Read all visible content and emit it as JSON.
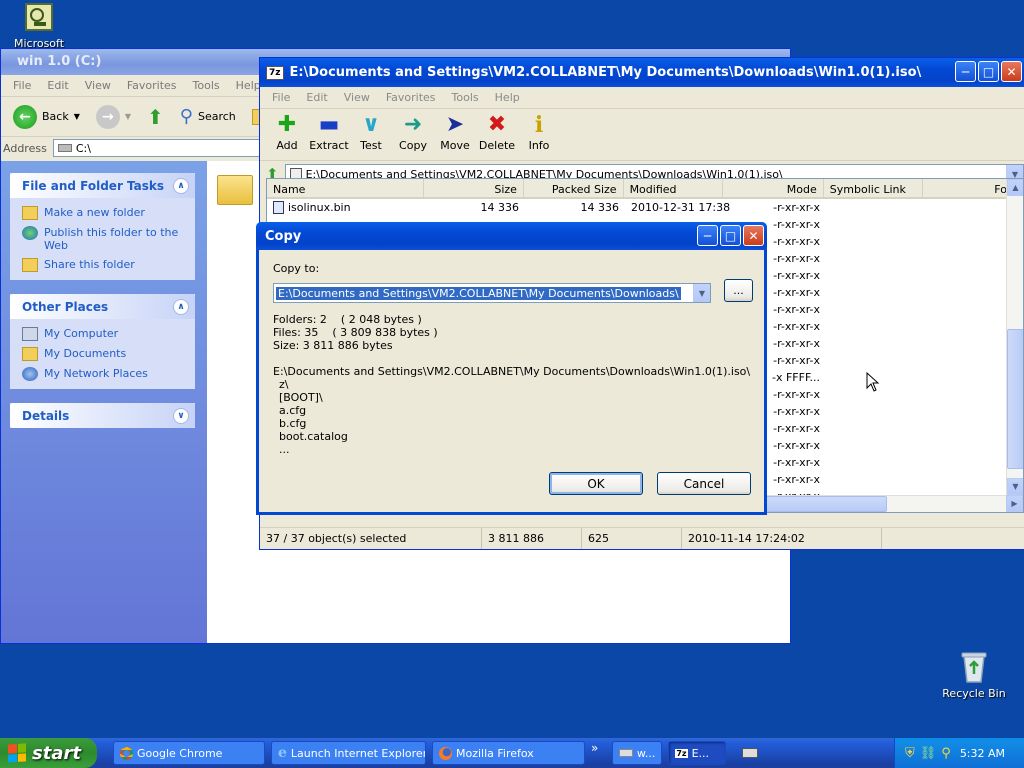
{
  "desktop": {
    "top_icon_label": "Microsoft",
    "recycle_label": "Recycle Bin"
  },
  "explorer": {
    "title": "win 1.0 (C:)",
    "menu": [
      "File",
      "Edit",
      "View",
      "Favorites",
      "Tools",
      "Help"
    ],
    "back_label": "Back",
    "search_label": "Search",
    "address_label": "Address",
    "address_value": "C:\\",
    "file_tasks": {
      "title": "File and Folder Tasks",
      "items": [
        "Make a new folder",
        "Publish this folder to the Web",
        "Share this folder"
      ]
    },
    "other_places": {
      "title": "Other Places",
      "items": [
        "My Computer",
        "My Documents",
        "My Network Places"
      ]
    },
    "details_title": "Details"
  },
  "zip": {
    "title": "E:\\Documents and Settings\\VM2.COLLABNET\\My Documents\\Downloads\\Win1.0(1).iso\\",
    "menu": [
      "File",
      "Edit",
      "View",
      "Favorites",
      "Tools",
      "Help"
    ],
    "toolbar": [
      "Add",
      "Extract",
      "Test",
      "Copy",
      "Move",
      "Delete",
      "Info"
    ],
    "path": "E:\\Documents and Settings\\VM2.COLLABNET\\My Documents\\Downloads\\Win1.0(1).iso\\",
    "columns": [
      "Name",
      "Size",
      "Packed Size",
      "Modified",
      "Mode",
      "Symbolic Link",
      "Fold"
    ],
    "first_row": {
      "name": "isolinux.bin",
      "size": "14 336",
      "packed": "14 336",
      "modified": "2010-12-31 17:38",
      "mode": "-r-xr-xr-x"
    },
    "modes": [
      "-r-xr-xr-x",
      "-r-xr-xr-x",
      "-r-xr-xr-x",
      "-r-xr-xr-x",
      "-r-xr-xr-x",
      "-r-xr-xr-x",
      "-r-xr-xr-x",
      "-r-xr-xr-x",
      "-r-xr-xr-x",
      "-x FFFF...",
      "-r-xr-xr-x",
      "-r-xr-xr-x",
      "-r-xr-xr-x",
      "-r-xr-xr-x",
      "-r-xr-xr-x",
      "-r-xr-xr-x",
      "-r-xr-xr-x",
      "-r-xr-xr-x"
    ],
    "status": [
      "37 / 37 object(s) selected",
      "3 811 886",
      "625",
      "2010-11-14 17:24:02"
    ]
  },
  "dialog": {
    "title": "Copy",
    "copy_to_label": "Copy to:",
    "destination": "E:\\Documents and Settings\\VM2.COLLABNET\\My Documents\\Downloads\\",
    "browse_label": "...",
    "folders": "Folders: 2    ( 2 048 bytes )",
    "files": "Files: 35    ( 3 809 838 bytes )",
    "size": "Size: 3 811 886 bytes",
    "source_path": "E:\\Documents and Settings\\VM2.COLLABNET\\My Documents\\Downloads\\Win1.0(1).iso\\",
    "items": [
      "z\\",
      "[BOOT]\\",
      "a.cfg",
      "b.cfg",
      "boot.catalog",
      "..."
    ],
    "ok_label": "OK",
    "cancel_label": "Cancel"
  },
  "taskbar": {
    "start_label": "start",
    "buttons": [
      "Google Chrome",
      "Launch Internet Explorer...",
      "Mozilla Firefox"
    ],
    "chevron": "»",
    "mini_buttons": [
      "w...",
      "E..."
    ],
    "clock": "5:32 AM"
  }
}
